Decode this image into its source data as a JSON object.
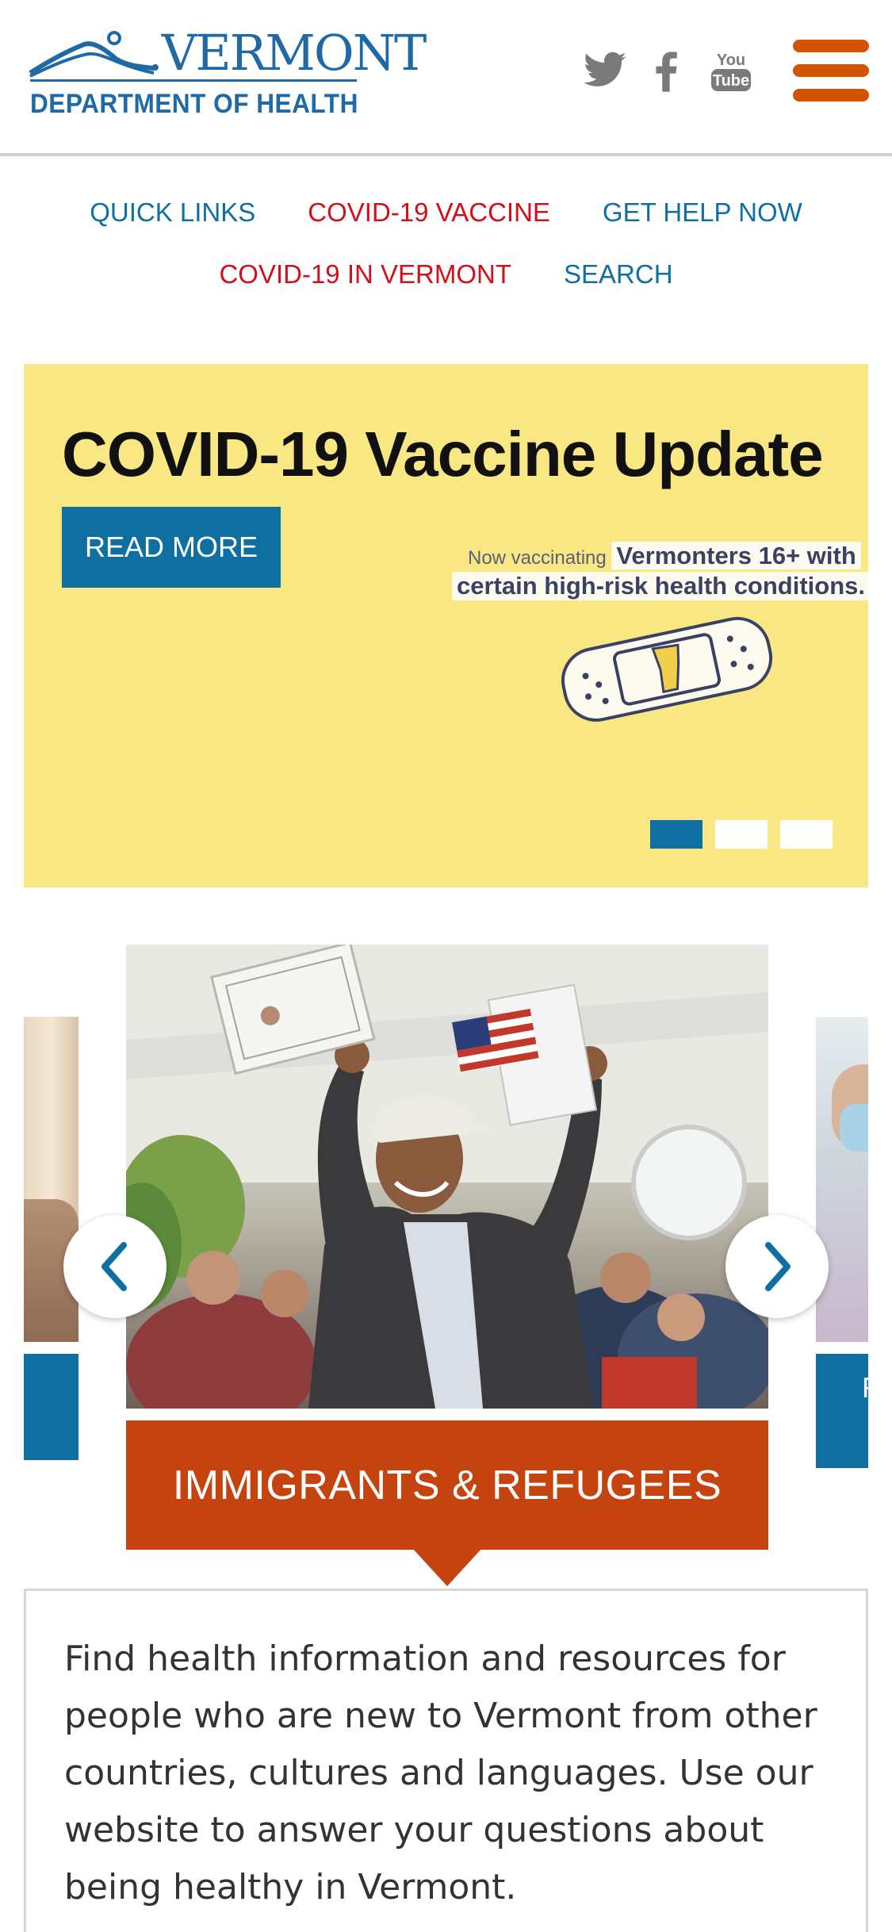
{
  "header": {
    "logo_top": ".VERMONT",
    "logo_bottom": "DEPARTMENT OF HEALTH",
    "social": {
      "youtube_line1": "You",
      "youtube_line2": "Tube"
    }
  },
  "nav": {
    "row1": [
      "QUICK LINKS",
      "COVID-19 VACCINE",
      "GET HELP NOW"
    ],
    "row2": [
      "COVID-19 IN VERMONT",
      "SEARCH"
    ]
  },
  "hero": {
    "title": "COVID-19 Vaccine Update",
    "button_label": "READ MORE",
    "image_text_small": "Now vaccinating ",
    "image_text_bold1": "Vermonters 16+ with",
    "image_text_bold2": "certain high-risk health conditions.",
    "slides_total": 3,
    "active_slide": 1
  },
  "carousel": {
    "right_card_label": "R",
    "card_title": "IMMIGRANTS & REFUGEES",
    "description": "Find health information and resources for people who are new to Vermont from other countries, cultures and languages. Use our website to answer your questions about being healthy in Vermont."
  },
  "colors": {
    "brand_blue": "#0f6fa0",
    "nav_red": "#d0101a",
    "menu_orange": "#d35400",
    "hero_yellow": "#f9e784",
    "card_orange": "#c4430e"
  }
}
